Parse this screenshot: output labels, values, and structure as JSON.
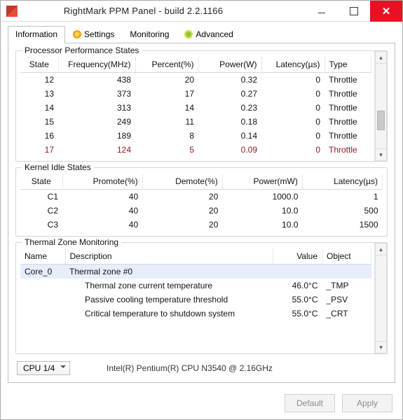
{
  "window": {
    "title": "RightMark PPM Panel - build 2.2.1166"
  },
  "tabs": {
    "information": "Information",
    "settings": "Settings",
    "monitoring": "Monitoring",
    "advanced": "Advanced"
  },
  "groups": {
    "ppstates": "Processor Performance States",
    "idle": "Kernel Idle States",
    "thermal": "Thermal Zone Monitoring"
  },
  "ppheaders": {
    "state": "State",
    "freq": "Frequency(MHz)",
    "pct": "Percent(%)",
    "power": "Power(W)",
    "lat": "Latency(µs)",
    "type": "Type"
  },
  "pprows": [
    {
      "state": "12",
      "freq": "438",
      "pct": "20",
      "power": "0.32",
      "lat": "0",
      "type": "Throttle",
      "hl": false
    },
    {
      "state": "13",
      "freq": "373",
      "pct": "17",
      "power": "0.27",
      "lat": "0",
      "type": "Throttle",
      "hl": false
    },
    {
      "state": "14",
      "freq": "313",
      "pct": "14",
      "power": "0.23",
      "lat": "0",
      "type": "Throttle",
      "hl": false
    },
    {
      "state": "15",
      "freq": "249",
      "pct": "11",
      "power": "0.18",
      "lat": "0",
      "type": "Throttle",
      "hl": false
    },
    {
      "state": "16",
      "freq": "189",
      "pct": "8",
      "power": "0.14",
      "lat": "0",
      "type": "Throttle",
      "hl": false
    },
    {
      "state": "17",
      "freq": "124",
      "pct": "5",
      "power": "0.09",
      "lat": "0",
      "type": "Throttle",
      "hl": true
    }
  ],
  "idleheaders": {
    "state": "State",
    "promote": "Promote(%)",
    "demote": "Demote(%)",
    "power": "Power(mW)",
    "lat": "Latency(µs)"
  },
  "idlerows": [
    {
      "state": "C1",
      "promote": "40",
      "demote": "20",
      "power": "1000.0",
      "lat": "1"
    },
    {
      "state": "C2",
      "promote": "40",
      "demote": "20",
      "power": "10.0",
      "lat": "500"
    },
    {
      "state": "C3",
      "promote": "40",
      "demote": "20",
      "power": "10.0",
      "lat": "1500"
    }
  ],
  "thermalheaders": {
    "name": "Name",
    "desc": "Description",
    "value": "Value",
    "object": "Object"
  },
  "thermalrows": [
    {
      "name": "Core_0",
      "desc": "Thermal zone #0",
      "value": "",
      "object": "",
      "indent": false,
      "sel": true
    },
    {
      "name": "",
      "desc": "Thermal zone current temperature",
      "value": "46.0°C",
      "object": "_TMP",
      "indent": true,
      "sel": false
    },
    {
      "name": "",
      "desc": "Passive cooling temperature threshold",
      "value": "55.0°C",
      "object": "_PSV",
      "indent": true,
      "sel": false
    },
    {
      "name": "",
      "desc": "Critical temperature to shutdown system",
      "value": "55.0°C",
      "object": "_CRT",
      "indent": true,
      "sel": false
    }
  ],
  "cpu": {
    "selected": "CPU 1/4",
    "model": "Intel(R) Pentium(R) CPU  N3540  @ 2.16GHz"
  },
  "buttons": {
    "default": "Default",
    "apply": "Apply"
  }
}
